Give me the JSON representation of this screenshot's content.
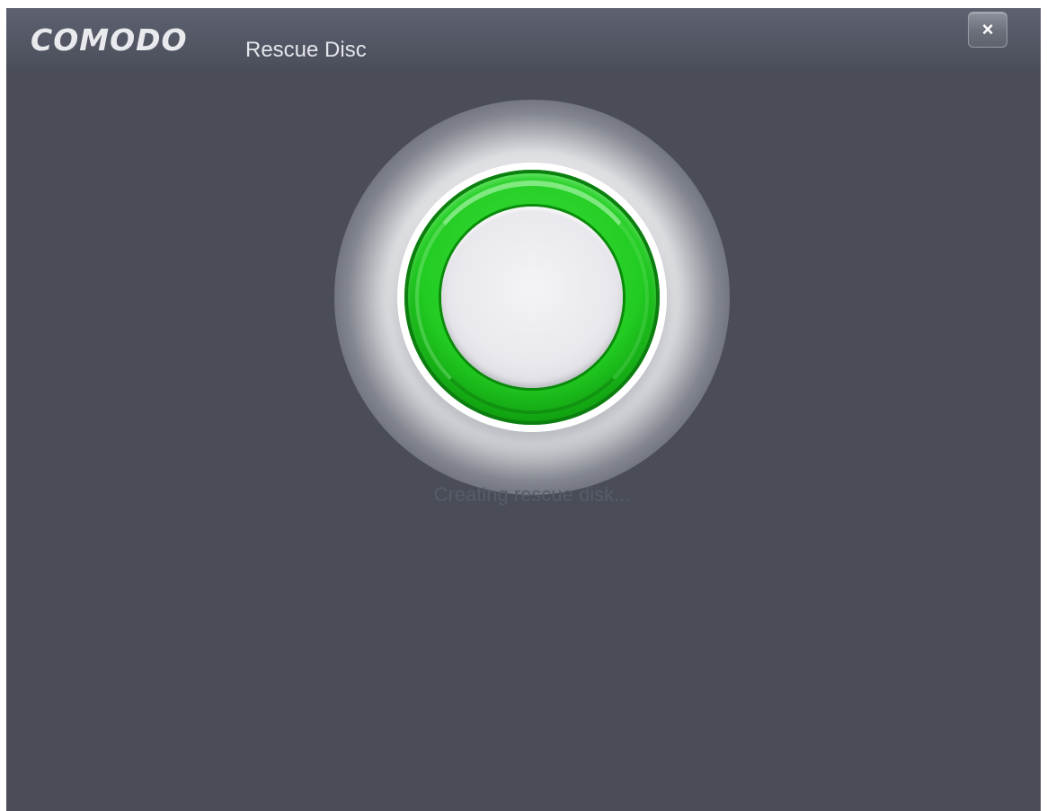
{
  "window": {
    "brand": "COMODO",
    "product": "Rescue Disc",
    "close_label": "×"
  },
  "main": {
    "status": "Creating rescue disk..."
  },
  "colors": {
    "background": "#4a4d58",
    "ring_accent": "#22cc22",
    "status_text": "#575c68"
  },
  "icons": {
    "close": "close-icon",
    "progress": "progress-ring-icon"
  }
}
